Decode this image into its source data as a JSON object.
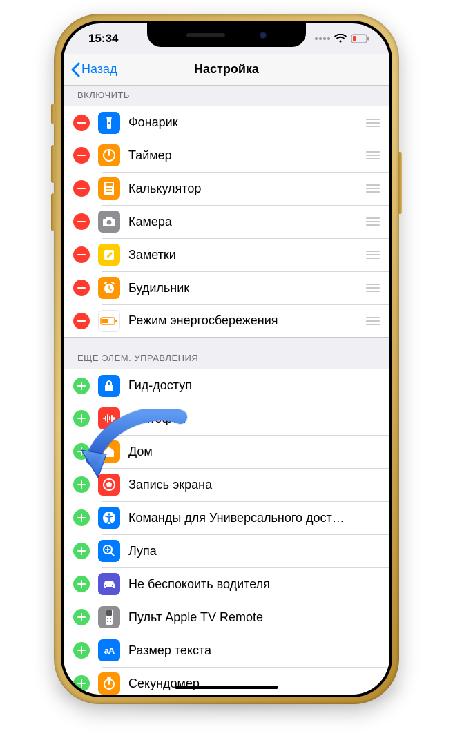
{
  "statusbar": {
    "time": "15:34"
  },
  "navbar": {
    "back": "Назад",
    "title": "Настройка"
  },
  "sections": {
    "included": {
      "header": "ВКЛЮЧИТЬ",
      "items": [
        {
          "label": "Фонарик"
        },
        {
          "label": "Таймер"
        },
        {
          "label": "Калькулятор"
        },
        {
          "label": "Камера"
        },
        {
          "label": "Заметки"
        },
        {
          "label": "Будильник"
        },
        {
          "label": "Режим энергосбережения"
        }
      ]
    },
    "more": {
      "header": "ЕЩЕ ЭЛЕМ. УПРАВЛЕНИЯ",
      "items": [
        {
          "label": "Гид-доступ"
        },
        {
          "label": "Диктофон"
        },
        {
          "label": "Дом"
        },
        {
          "label": "Запись экрана"
        },
        {
          "label": "Команды для Универсального дост…"
        },
        {
          "label": "Лупа"
        },
        {
          "label": "Не беспокоить водителя"
        },
        {
          "label": "Пульт Apple TV Remote"
        },
        {
          "label": "Размер текста"
        },
        {
          "label": "Секундомер"
        }
      ]
    }
  },
  "annotation": {
    "target": "Запись экрана"
  }
}
